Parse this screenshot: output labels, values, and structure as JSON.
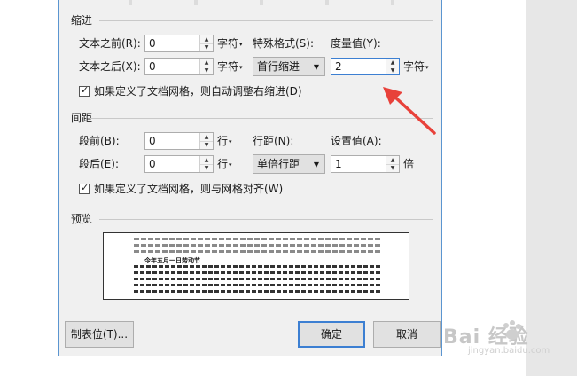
{
  "indent": {
    "section_label": "缩进",
    "before_text_label": "文本之前(R):",
    "before_text_value": "0",
    "before_text_unit": "字符",
    "after_text_label": "文本之后(X):",
    "after_text_value": "0",
    "after_text_unit": "字符",
    "special_label": "特殊格式(S):",
    "special_value": "首行缩进",
    "measure_label": "度量值(Y):",
    "measure_value": "2",
    "measure_unit": "字符",
    "grid_check_label": "如果定义了文档网格，则自动调整右缩进(D)",
    "grid_checked": true
  },
  "spacing": {
    "section_label": "间距",
    "before_label": "段前(B):",
    "before_value": "0",
    "before_unit": "行",
    "after_label": "段后(E):",
    "after_value": "0",
    "after_unit": "行",
    "line_label": "行距(N):",
    "line_value": "单倍行距",
    "setvalue_label": "设置值(A):",
    "setvalue_value": "1",
    "setvalue_unit": "倍",
    "grid_check_label": "如果定义了文档网格，则与网格对齐(W)",
    "grid_checked": true
  },
  "preview": {
    "section_label": "预览",
    "sample_text": "今年五月一日劳动节"
  },
  "buttons": {
    "tabs": "制表位(T)...",
    "ok": "确定",
    "cancel": "取消"
  },
  "watermark": {
    "text": "Bai 经验",
    "url": "jingyan.baidu.com"
  },
  "colors": {
    "dialog_bg": "#f0f0f0",
    "focus_border": "#3c7fd2",
    "annotation_arrow": "#e8413a"
  }
}
